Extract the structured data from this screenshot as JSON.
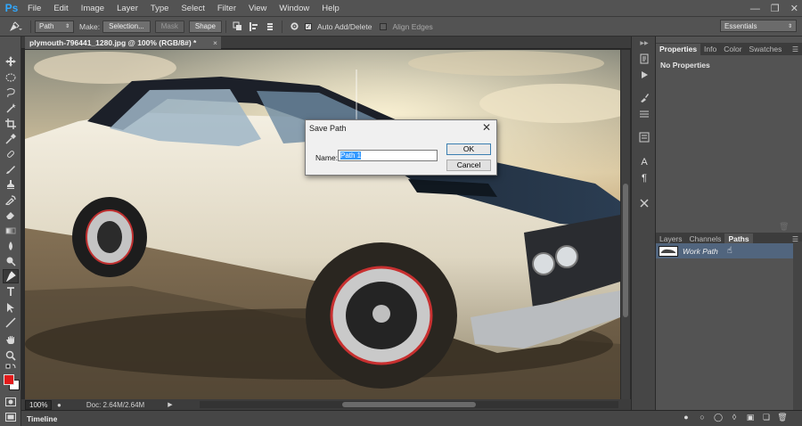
{
  "app": {
    "logo": "Ps",
    "menu": [
      "File",
      "Edit",
      "Image",
      "Layer",
      "Type",
      "Select",
      "Filter",
      "View",
      "Window",
      "Help"
    ]
  },
  "options_bar": {
    "mode_value": "Path",
    "make_label": "Make:",
    "selection_btn": "Selection...",
    "mask_btn": "Mask",
    "shape_btn": "Shape",
    "auto_add_delete": "Auto Add/Delete",
    "auto_add_delete_checked": true,
    "align_edges": "Align Edges",
    "align_edges_checked": false,
    "workspace": "Essentials"
  },
  "document": {
    "tab_title": "plymouth-796441_1280.jpg @ 100% (RGB/8#) *",
    "tab_close": "×",
    "zoom": "100%",
    "doc_info": "Doc: 2.64M/2.64M"
  },
  "dialog": {
    "title": "Save Path",
    "close": "✕",
    "name_label": "Name:",
    "name_value": "Path 1",
    "ok": "OK",
    "cancel": "Cancel"
  },
  "properties_panel": {
    "tabs": [
      "Properties",
      "Info",
      "Color",
      "Swatches"
    ],
    "active_tab": "Properties",
    "content": "No Properties"
  },
  "layers_panel": {
    "tabs": [
      "Layers",
      "Channels",
      "Paths"
    ],
    "active_tab": "Paths",
    "paths": [
      {
        "name": "Work Path"
      }
    ]
  },
  "timeline": {
    "label": "Timeline"
  },
  "colors": {
    "foreground": "#e21a1a",
    "background": "#ffffff",
    "selection": "#51657e"
  }
}
